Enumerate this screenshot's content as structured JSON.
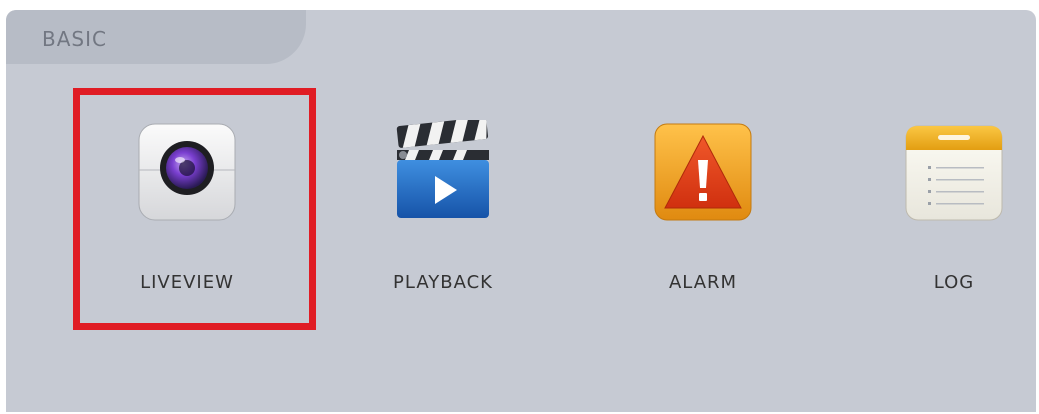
{
  "section": {
    "title": "BASIC"
  },
  "tiles": [
    {
      "label": "LIVEVIEW",
      "icon": "camera-lens-icon",
      "selected": true
    },
    {
      "label": "PLAYBACK",
      "icon": "clapperboard-play-icon",
      "selected": false
    },
    {
      "label": "ALARM",
      "icon": "warning-triangle-icon",
      "selected": false
    },
    {
      "label": "LOG",
      "icon": "notepad-list-icon",
      "selected": false
    }
  ],
  "colors": {
    "panel_bg": "#c6cad3",
    "tab_bg": "#b7bcc6",
    "selection": "#e01c24",
    "playback_blue": "#1f6fc4",
    "alarm_orange": "#f0a020",
    "alarm_red": "#e0401c",
    "log_yellow": "#f2b321"
  }
}
